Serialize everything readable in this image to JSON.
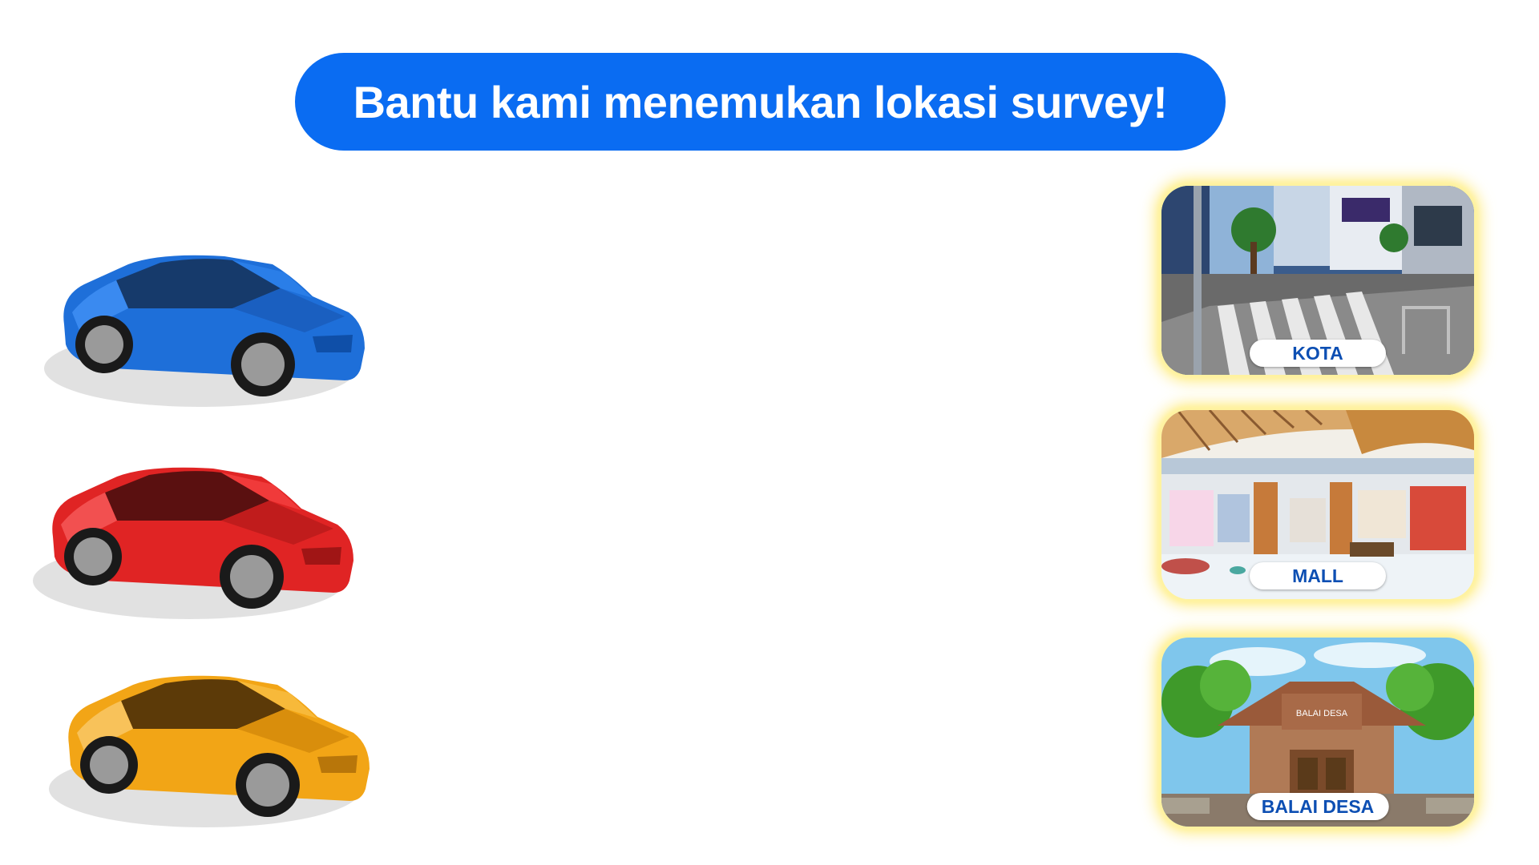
{
  "header": {
    "title": "Bantu kami menemukan lokasi survey!"
  },
  "cars": [
    {
      "name": "car-blue",
      "color": "#1e6fd9"
    },
    {
      "name": "car-red",
      "color": "#e02424"
    },
    {
      "name": "car-yellow",
      "color": "#f2a516"
    }
  ],
  "locations": [
    {
      "label": "KOTA"
    },
    {
      "label": "MALL"
    },
    {
      "label": "BALAI DESA",
      "sign": "BALAI DESA"
    }
  ],
  "colors": {
    "banner": "#0a6cf2",
    "label_text": "#0d4fb3",
    "card_glow": "#fff3a0"
  }
}
